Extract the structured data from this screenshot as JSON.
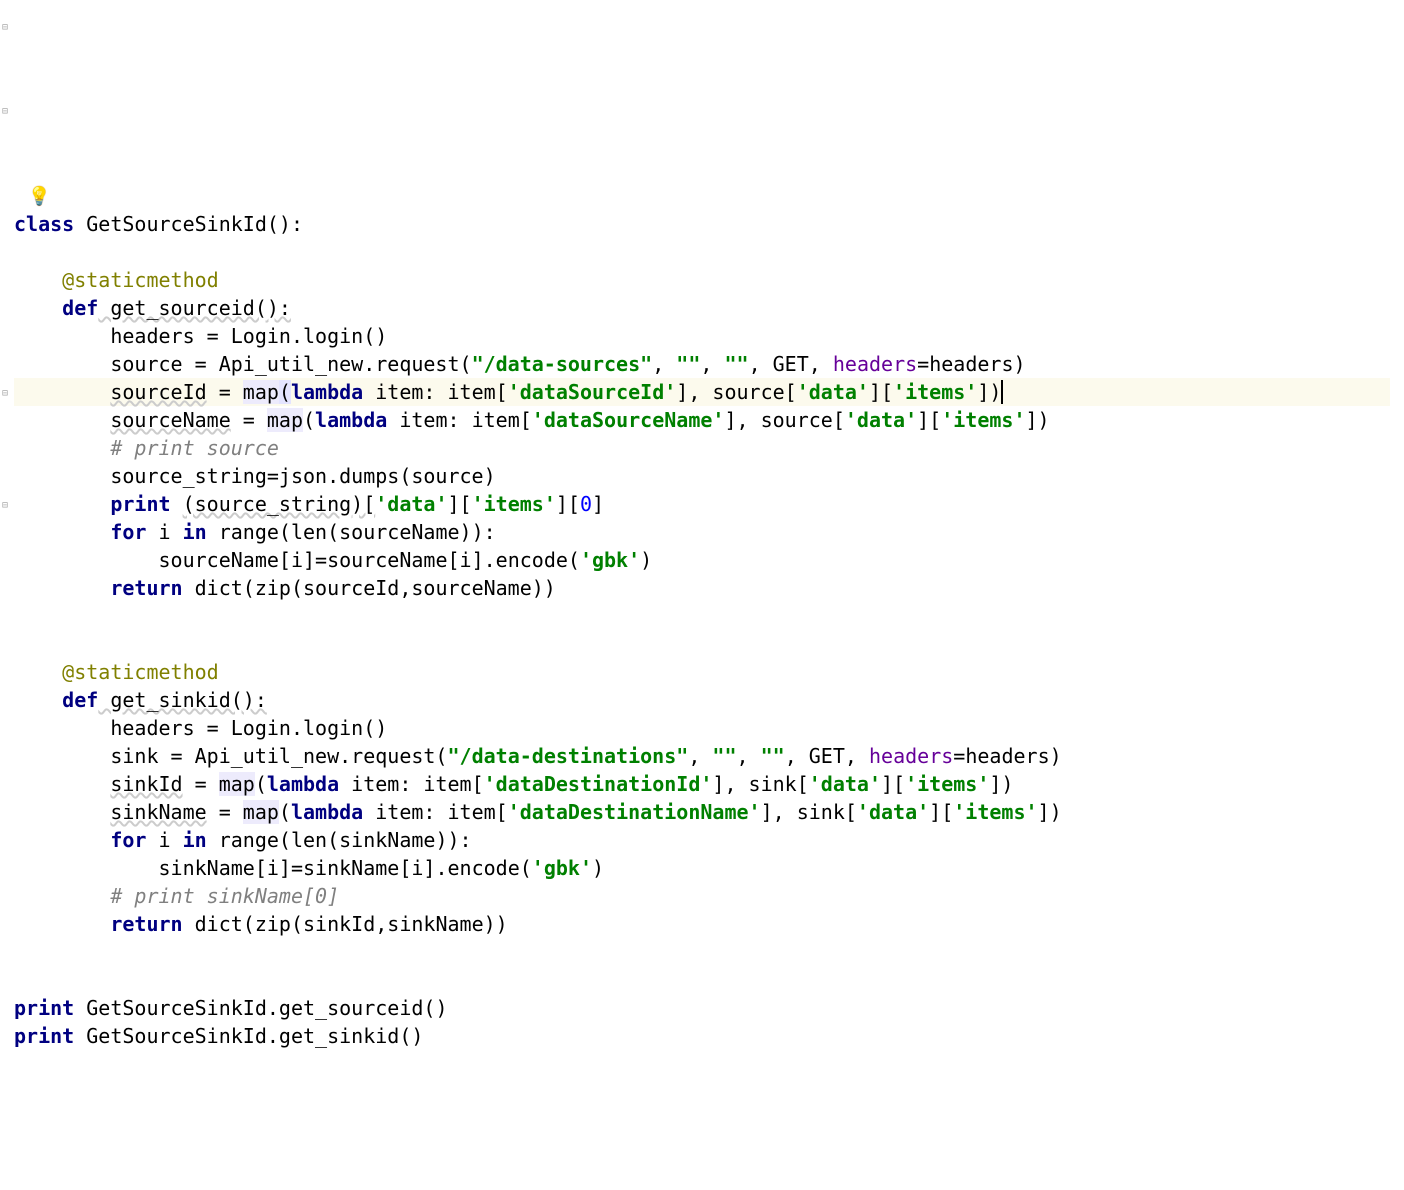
{
  "code": {
    "l1_class": "class",
    "l1_name": " GetSourceSinkId():",
    "l3_dec": "@staticmethod",
    "l4_def": "def",
    "l4_name": " get_sourceid():",
    "l5": "headers = Login.login()",
    "l6_a": "source = Api_util_new.request(",
    "l6_s1": "\"/data-sources\"",
    "l6_b": ", ",
    "l6_s2": "\"\"",
    "l6_c": ", ",
    "l6_s3": "\"\"",
    "l6_d": ", GET, ",
    "l6_p": "headers",
    "l6_e": "=headers)",
    "l7_a": "sourceId",
    "l7_b": " = ",
    "l7_map": "map",
    "l7_c": "(",
    "l7_lam": "lambda",
    "l7_d": " item: item[",
    "l7_s1": "'dataSourceId'",
    "l7_e": "], source[",
    "l7_s2": "'data'",
    "l7_f": "][",
    "l7_s3": "'items'",
    "l7_g": "])",
    "l8_a": "sourceName",
    "l8_b": " = ",
    "l8_map": "map",
    "l8_c": "(",
    "l8_lam": "lambda",
    "l8_d": " item: item[",
    "l8_s1": "'dataSourceName'",
    "l8_e": "], source[",
    "l8_s2": "'data'",
    "l8_f": "][",
    "l8_s3": "'items'",
    "l8_g": "])",
    "l9_c": "# print source",
    "l10": "source_string=json.dumps(source)",
    "l11_kw": "print ",
    "l11_a": "(source_string)[",
    "l11_s1": "'data'",
    "l11_b": "][",
    "l11_s2": "'items'",
    "l11_c": "][",
    "l11_n": "0",
    "l11_d": "]",
    "l12_for": "for",
    "l12_a": " i ",
    "l12_in": "in",
    "l12_b": " range(len(sourceName)):",
    "l13_a": "sourceName[i]=sourceName[i].encode(",
    "l13_s": "'gbk'",
    "l13_b": ")",
    "l14_ret": "return",
    "l14_a": " dict(zip(sourceId,sourceName))",
    "l17_dec": "@staticmethod",
    "l18_def": "def",
    "l18_name": " get_sinkid():",
    "l19": "headers = Login.login()",
    "l20_a": "sink = Api_util_new.request(",
    "l20_s1": "\"/data-destinations\"",
    "l20_b": ", ",
    "l20_s2": "\"\"",
    "l20_c": ", ",
    "l20_s3": "\"\"",
    "l20_d": ", GET, ",
    "l20_p": "headers",
    "l20_e": "=headers)",
    "l21_a": "sinkId",
    "l21_b": " = ",
    "l21_map": "map",
    "l21_c": "(",
    "l21_lam": "lambda",
    "l21_d": " item: item[",
    "l21_s1": "'dataDestinationId'",
    "l21_e": "], sink[",
    "l21_s2": "'data'",
    "l21_f": "][",
    "l21_s3": "'items'",
    "l21_g": "])",
    "l22_a": "sinkName",
    "l22_b": " = ",
    "l22_map": "map",
    "l22_c": "(",
    "l22_lam": "lambda",
    "l22_d": " item: item[",
    "l22_s1": "'dataDestinationName'",
    "l22_e": "], sink[",
    "l22_s2": "'data'",
    "l22_f": "][",
    "l22_s3": "'items'",
    "l22_g": "])",
    "l23_for": "for",
    "l23_a": " i ",
    "l23_in": "in",
    "l23_b": " range(len(sinkName)):",
    "l24_a": "sinkName[i]=sinkName[i].encode(",
    "l24_s": "'gbk'",
    "l24_b": ")",
    "l25_c": "# print sinkName[0]",
    "l26_ret": "return",
    "l26_a": " dict(zip(sinkId,sinkName))",
    "l29_kw": "print",
    "l29_a": " GetSourceSinkId.get_sourceid()",
    "l30_kw": "print",
    "l30_a": " GetSourceSinkId.get_sinkid()"
  }
}
